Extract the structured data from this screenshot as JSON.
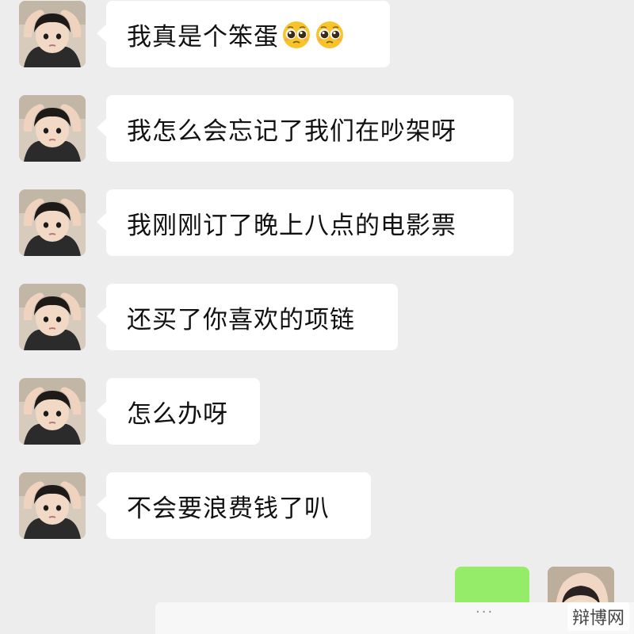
{
  "messages": [
    {
      "text": "我真是个笨蛋",
      "emojis": [
        "pleading-face-icon",
        "pleading-face-icon"
      ]
    },
    {
      "text": "我怎么会忘记了我们在吵架呀"
    },
    {
      "text": "我刚刚订了晚上八点的电影票"
    },
    {
      "text": "还买了你喜欢的项链"
    },
    {
      "text": "怎么办呀"
    },
    {
      "text": "不会要浪费钱了叭"
    }
  ],
  "composer": {
    "more_label": "···"
  },
  "watermark": "辩博网",
  "colors": {
    "background": "#ededed",
    "bubble": "#ffffff",
    "self_bubble": "#95ec69"
  }
}
